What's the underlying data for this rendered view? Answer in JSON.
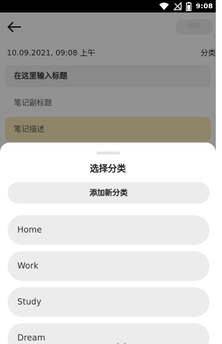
{
  "status_bar": {
    "time": "9:08",
    "icons": [
      "wifi-icon",
      "no-signal-icon",
      "battery-icon"
    ]
  },
  "editor": {
    "save_label": "保存",
    "date": "10.09.2021, 09:08 上午",
    "category_label": "分类",
    "title_placeholder": "在这里输入标题",
    "subtitle_placeholder": "笔记副标题",
    "description_placeholder": "笔记描述",
    "description_color": "#f6e6b6"
  },
  "sheet": {
    "title": "选择分类",
    "add_label": "添加新分类",
    "categories": [
      {
        "label": "Home"
      },
      {
        "label": "Work"
      },
      {
        "label": "Study"
      },
      {
        "label": "Dream"
      }
    ]
  }
}
